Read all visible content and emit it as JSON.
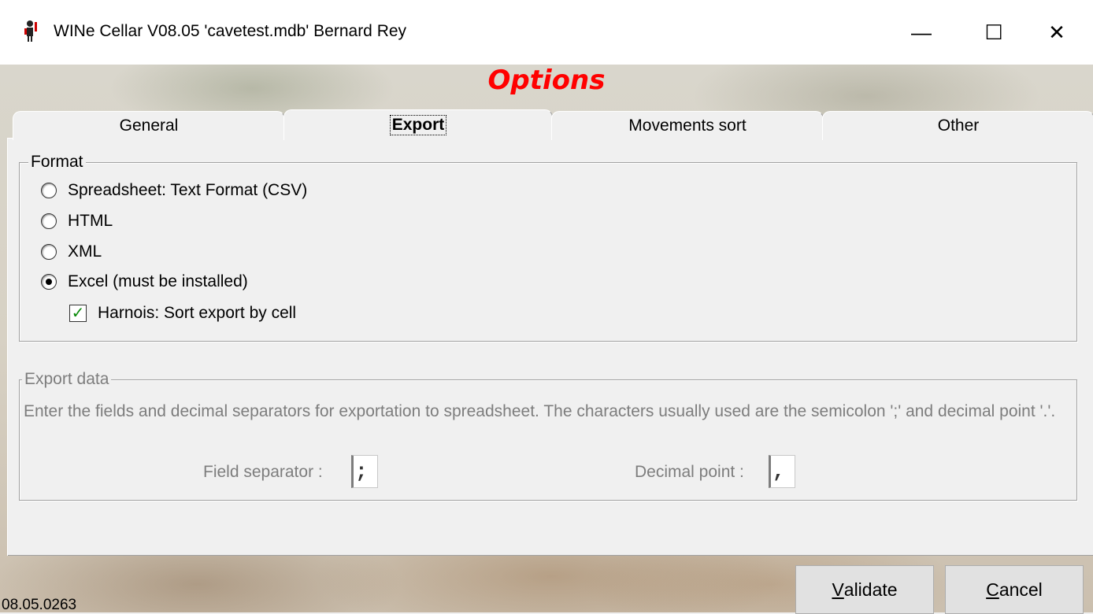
{
  "window": {
    "title": "WINe Cellar V08.05  'cavetest.mdb'  Bernard Rey",
    "minimize_glyph": "—",
    "maximize_glyph": "☐",
    "close_glyph": "✕"
  },
  "heading": "Options",
  "tabs": [
    {
      "label": "General",
      "selected": false
    },
    {
      "label": "Export",
      "selected": true
    },
    {
      "label": "Movements sort",
      "selected": false
    },
    {
      "label": "Other",
      "selected": false
    }
  ],
  "format": {
    "legend": "Format",
    "options": [
      {
        "label": "Spreadsheet: Text Format (CSV)",
        "selected": false
      },
      {
        "label": "HTML",
        "selected": false
      },
      {
        "label": "XML",
        "selected": false
      },
      {
        "label": "Excel (must be installed)",
        "selected": true
      }
    ],
    "harnois": {
      "label": "Harnois: Sort export by cell",
      "checked": true
    }
  },
  "export_data": {
    "legend": "Export data",
    "description": "Enter the fields and decimal separators for exportation to spreadsheet. The characters usually used are the semicolon ';' and decimal point '.'.",
    "field_separator_label": "Field separator :",
    "field_separator_value": ";",
    "decimal_point_label": "Decimal point :",
    "decimal_point_value": ","
  },
  "footer": {
    "version": "08.05.0263",
    "validate": {
      "accel": "V",
      "rest": "alidate"
    },
    "cancel": {
      "accel": "C",
      "rest": "ancel"
    }
  },
  "colors": {
    "heading": "#ff0000",
    "check": "#0a8a0a",
    "disabled_text": "#7d7d7d"
  }
}
